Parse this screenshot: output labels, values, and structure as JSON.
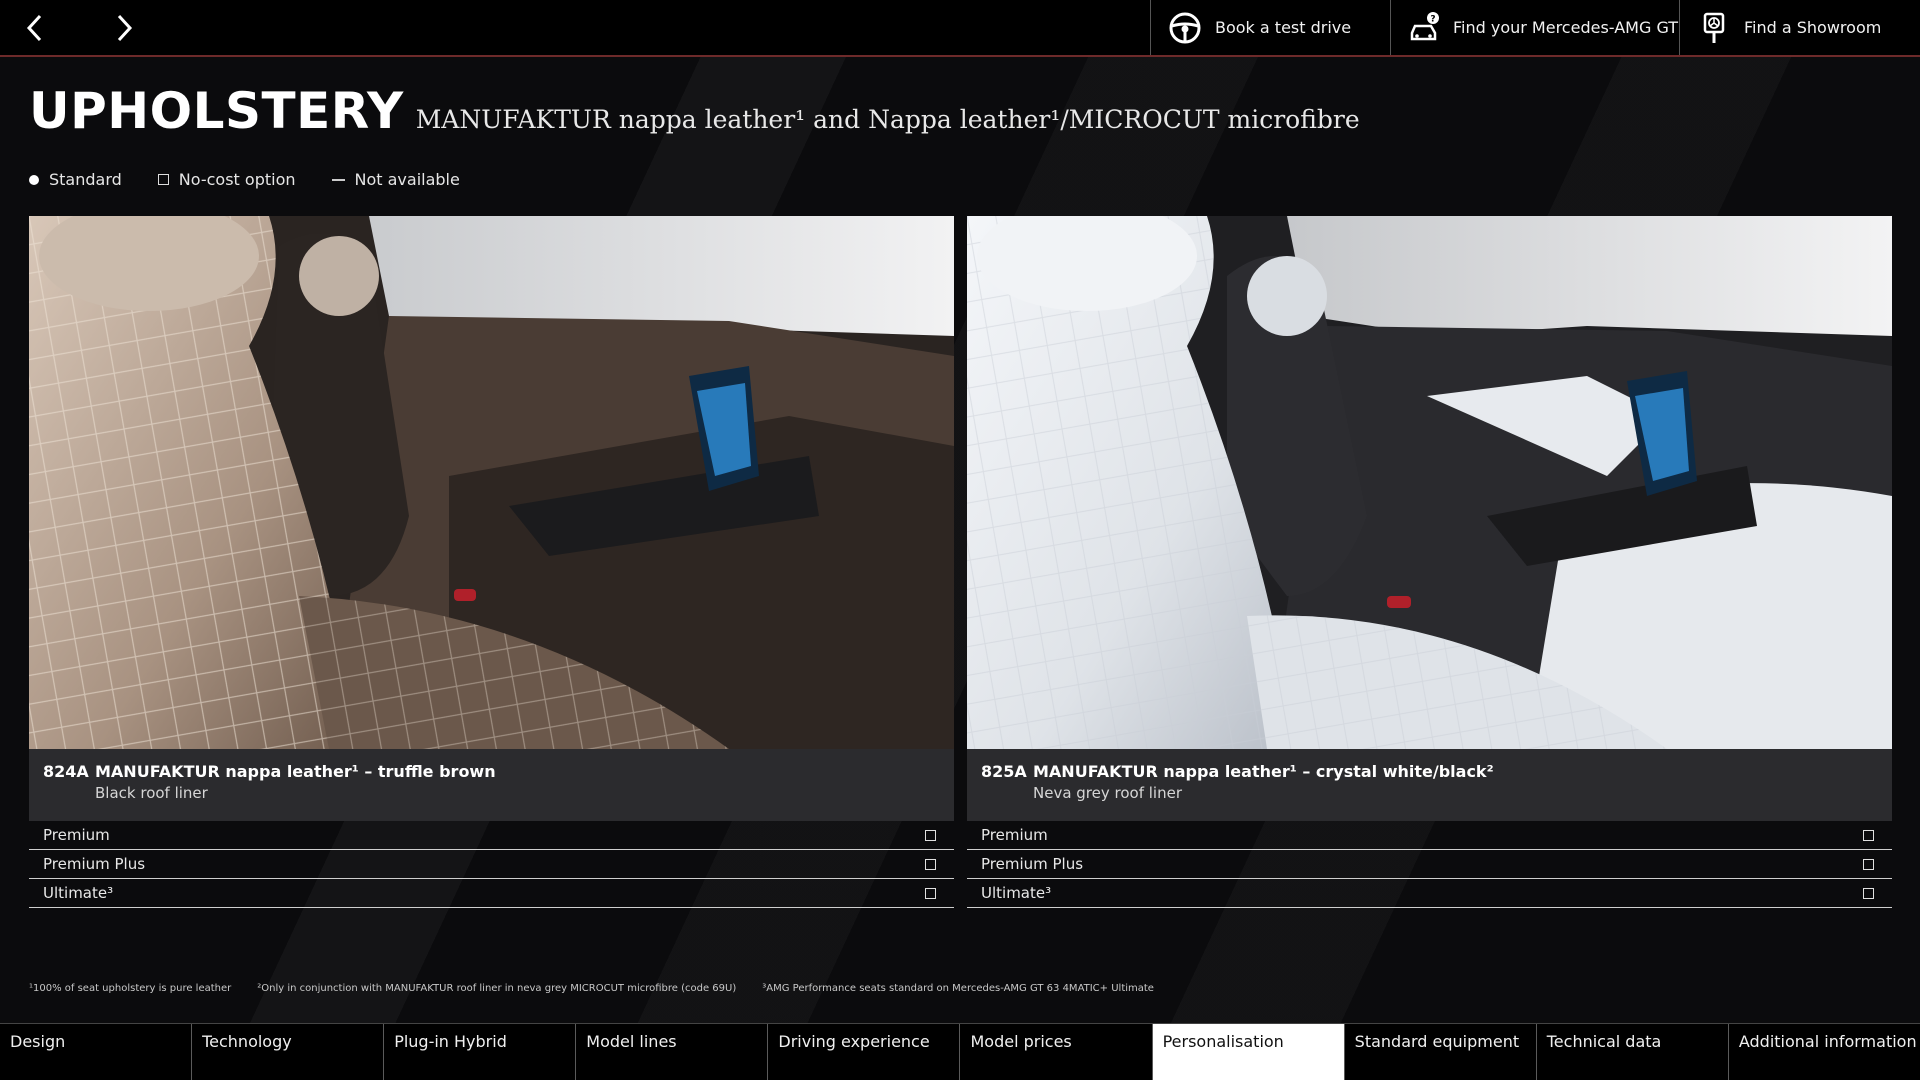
{
  "topbar": {
    "actions": [
      {
        "label": "Book a test drive",
        "icon": "steering-wheel-icon"
      },
      {
        "label": "Find your Mercedes-AMG GT",
        "icon": "car-question-icon"
      },
      {
        "label": "Find a Showroom",
        "icon": "map-pin-icon"
      }
    ]
  },
  "header": {
    "title": "UPHOLSTERY",
    "subtitle": "MANUFAKTUR nappa leather¹ and Nappa leather¹/MICROCUT microfibre"
  },
  "legend": {
    "standard": "Standard",
    "no_cost": "No-cost option",
    "not_available": "Not available"
  },
  "cards": [
    {
      "code": "824A",
      "name": "MANUFAKTUR nappa leather¹ – truffle brown",
      "liner": "Black roof liner",
      "options": [
        {
          "label": "Premium",
          "status": "no-cost"
        },
        {
          "label": "Premium Plus",
          "status": "no-cost"
        },
        {
          "label": "Ultimate³",
          "status": "no-cost"
        }
      ]
    },
    {
      "code": "825A",
      "name": "MANUFAKTUR nappa leather¹ – crystal white/black²",
      "liner": "Neva grey roof liner",
      "options": [
        {
          "label": "Premium",
          "status": "no-cost"
        },
        {
          "label": "Premium Plus",
          "status": "no-cost"
        },
        {
          "label": "Ultimate³",
          "status": "no-cost"
        }
      ]
    }
  ],
  "footnotes": [
    "¹100% of seat upholstery is pure leather",
    "²Only in conjunction with MANUFAKTUR roof liner in neva grey MICROCUT microfibre (code 69U)",
    "³AMG Performance seats standard on Mercedes-AMG GT 63 4MATIC+ Ultimate"
  ],
  "bottom_nav": {
    "items": [
      "Design",
      "Technology",
      "Plug-in Hybrid",
      "Model lines",
      "Driving experience",
      "Model prices",
      "Personalisation",
      "Standard equipment",
      "Technical data",
      "Additional information"
    ],
    "active": "Personalisation"
  },
  "colors": {
    "background": "#0b0b0d",
    "accent_line": "#6e2a2a",
    "caption_bg": "#2b2b2e"
  }
}
